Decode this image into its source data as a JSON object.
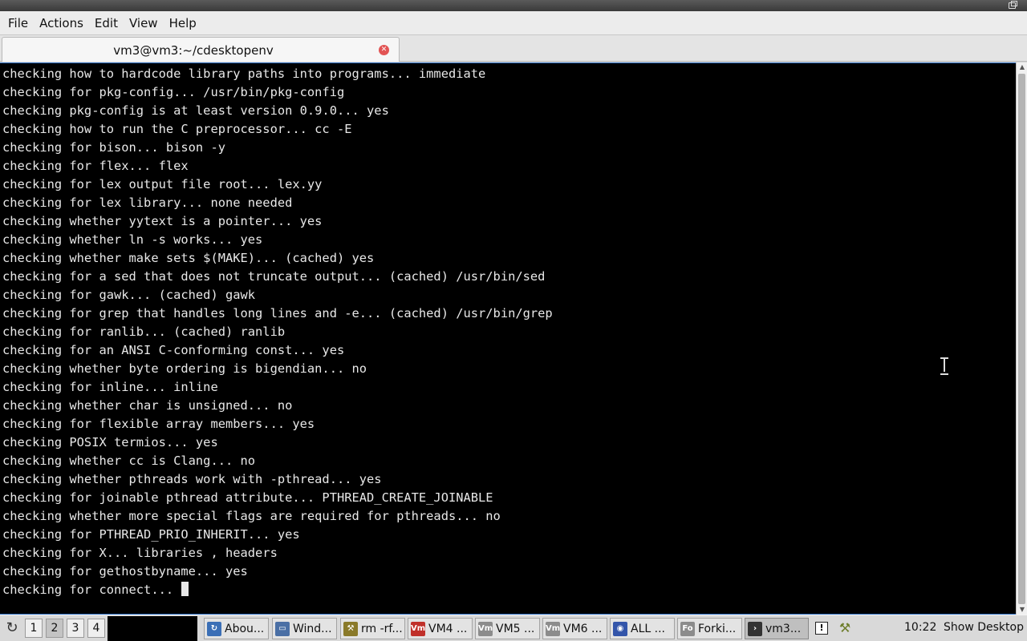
{
  "menubar": {
    "items": [
      "File",
      "Actions",
      "Edit",
      "View",
      "Help"
    ]
  },
  "tab": {
    "title": "vm3@vm3:~/cdesktopenv",
    "close_icon": "close-icon"
  },
  "terminal": {
    "lines": [
      "checking how to hardcode library paths into programs... immediate",
      "checking for pkg-config... /usr/bin/pkg-config",
      "checking pkg-config is at least version 0.9.0... yes",
      "checking how to run the C preprocessor... cc -E",
      "checking for bison... bison -y",
      "checking for flex... flex",
      "checking for lex output file root... lex.yy",
      "checking for lex library... none needed",
      "checking whether yytext is a pointer... yes",
      "checking whether ln -s works... yes",
      "checking whether make sets $(MAKE)... (cached) yes",
      "checking for a sed that does not truncate output... (cached) /usr/bin/sed",
      "checking for gawk... (cached) gawk",
      "checking for grep that handles long lines and -e... (cached) /usr/bin/grep",
      "checking for ranlib... (cached) ranlib",
      "checking for an ANSI C-conforming const... yes",
      "checking whether byte ordering is bigendian... no",
      "checking for inline... inline",
      "checking whether char is unsigned... no",
      "checking for flexible array members... yes",
      "checking POSIX termios... yes",
      "checking whether cc is Clang... no",
      "checking whether pthreads work with -pthread... yes",
      "checking for joinable pthread attribute... PTHREAD_CREATE_JOINABLE",
      "checking whether more special flags are required for pthreads... no",
      "checking for PTHREAD_PRIO_INHERIT... yes",
      "checking for X... libraries , headers",
      "checking for gethostbyname... yes",
      "checking for connect... "
    ]
  },
  "taskbar": {
    "workspaces": [
      "1",
      "2",
      "3",
      "4"
    ],
    "active_workspace": "2",
    "tasks": [
      {
        "label": "Abou...",
        "icon": "xfce-mouse-icon",
        "color": "#3b6fb6",
        "active": false
      },
      {
        "label": "Wind...",
        "icon": "window-icon",
        "color": "#4a6fa5",
        "active": false
      },
      {
        "label": "rm -rf...",
        "icon": "tools-icon",
        "color": "#8a7a2a",
        "active": false
      },
      {
        "label": "VM4 ...",
        "icon": "vm-icon",
        "color": "#c0302a",
        "active": false
      },
      {
        "label": "VM5 ...",
        "icon": "vm-icon",
        "color": "#8c8c8c",
        "active": false
      },
      {
        "label": "VM6 ...",
        "icon": "vm-icon",
        "color": "#8c8c8c",
        "active": false
      },
      {
        "label": "ALL ...",
        "icon": "globe-icon",
        "color": "#3355aa",
        "active": false
      },
      {
        "label": "Forki...",
        "icon": "fo-icon",
        "color": "#8c8c8c",
        "active": false
      },
      {
        "label": "vm3...",
        "icon": "terminal-icon",
        "color": "#333333",
        "active": true
      }
    ],
    "vm_icon_text": "Vm",
    "fo_icon_text": "Fo",
    "clock": "10:22",
    "show_desktop": "Show Desktop"
  }
}
